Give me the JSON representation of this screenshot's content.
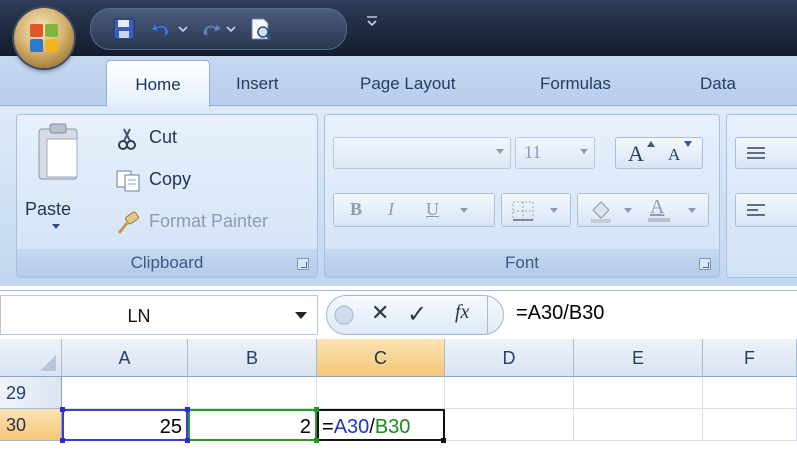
{
  "quick_access": {
    "items": [
      "save-icon",
      "undo-icon",
      "redo-icon",
      "print-preview-icon",
      "customize-icon"
    ]
  },
  "tabs": [
    {
      "label": "Home",
      "active": true
    },
    {
      "label": "Insert"
    },
    {
      "label": "Page Layout"
    },
    {
      "label": "Formulas"
    },
    {
      "label": "Data"
    }
  ],
  "clipboard": {
    "paste": "Paste",
    "cut": "Cut",
    "copy": "Copy",
    "format_painter": "Format Painter",
    "group_label": "Clipboard"
  },
  "font": {
    "font_size": "11",
    "grow_label": "A",
    "shrink_label": "A",
    "bold": "B",
    "italic": "I",
    "underline": "U",
    "font_color_label": "A",
    "group_label": "Font"
  },
  "formula_bar": {
    "name_box": "LN",
    "cancel": "✕",
    "enter": "✓",
    "fx": "fx",
    "formula": "=A30/B30"
  },
  "grid": {
    "columns": [
      "A",
      "B",
      "C",
      "D",
      "E",
      "F"
    ],
    "selected_column": "C",
    "rows": [
      {
        "number": "29",
        "cells": {}
      },
      {
        "number": "30",
        "cells": {
          "A": "25",
          "B": "2"
        }
      }
    ],
    "active_row": "30",
    "editing_cell": {
      "prefix": "=",
      "ref1": "A30",
      "separator": "/",
      "ref2": "B30"
    },
    "colors": {
      "ref1": "#1f34c7",
      "ref2": "#1a8a1a",
      "selected_header": "#f5c777"
    }
  }
}
